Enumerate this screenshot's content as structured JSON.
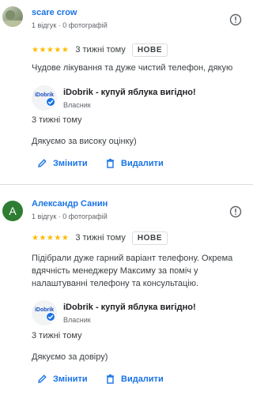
{
  "reviews": [
    {
      "author": "scare crow",
      "meta": "1 відгук · 0 фотографій",
      "stars": "★★★★★",
      "rating_date": "3 тижні тому",
      "badge": "НОВЕ",
      "text": [
        "Чудове лікування та дуже чистий телефон, дякую"
      ],
      "reply": {
        "logo_text": "iDobrik",
        "owner_name": "iDobrik - купуй яблука вигідно!",
        "owner_role": "Власник",
        "date": "3 тижні тому",
        "text": "Дякуємо за високу оцінку)"
      },
      "actions": {
        "edit": "Змінити",
        "delete": "Видалити"
      }
    },
    {
      "author": "Александр Санин",
      "avatar_letter": "A",
      "meta": "1 відгук · 0 фотографій",
      "stars": "★★★★★",
      "rating_date": "3 тижні тому",
      "badge": "НОВЕ",
      "text": [
        "Підібрали дуже гарний варіант телефону. Окрема",
        "вдячність менеджеру Максиму за поміч у",
        "налаштуванні телефону та консультацію."
      ],
      "reply": {
        "logo_text": "iDobrik",
        "owner_name": "iDobrik - купуй яблука вигідно!",
        "owner_role": "Власник",
        "date": "3 тижні тому",
        "text": "Дякуємо за довіру)"
      },
      "actions": {
        "edit": "Змінити",
        "delete": "Видалити"
      }
    }
  ],
  "colors": {
    "author_link": "#1a73e8",
    "star": "#fbbc04",
    "avatar_green": "#2e7d32",
    "action_blue": "#1a73e8"
  },
  "icons": [
    "report-icon",
    "star-icon",
    "verified-check-icon",
    "pencil-icon",
    "trash-icon"
  ]
}
